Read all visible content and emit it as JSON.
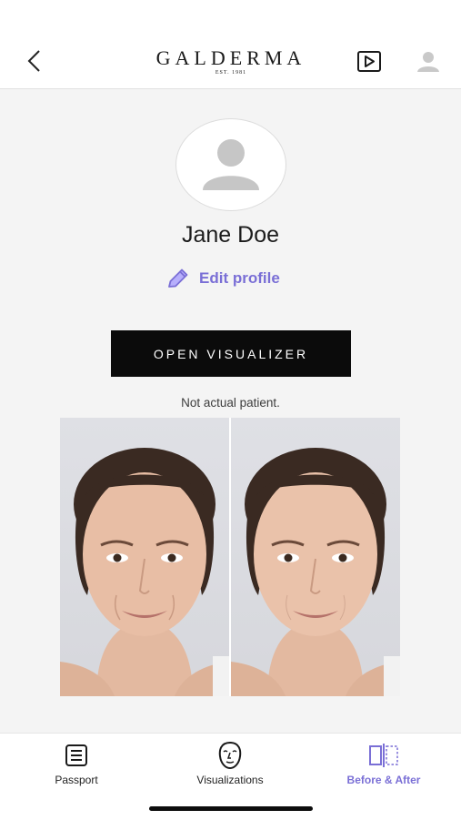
{
  "header": {
    "logo_text": "GALDERMA",
    "logo_subtext": "EST. 1981"
  },
  "profile": {
    "name": "Jane Doe",
    "edit_label": "Edit profile"
  },
  "visualizer": {
    "button_label": "OPEN VISUALIZER",
    "disclaimer": "Not actual patient."
  },
  "nav": {
    "items": [
      {
        "label": "Passport",
        "icon": "passport-icon"
      },
      {
        "label": "Visualizations",
        "icon": "face-icon"
      },
      {
        "label": "Before & After",
        "icon": "before-after-icon",
        "active": true
      }
    ]
  },
  "colors": {
    "accent": "#7a6fd6",
    "button_bg": "#0b0b0b",
    "background": "#f4f4f4"
  }
}
